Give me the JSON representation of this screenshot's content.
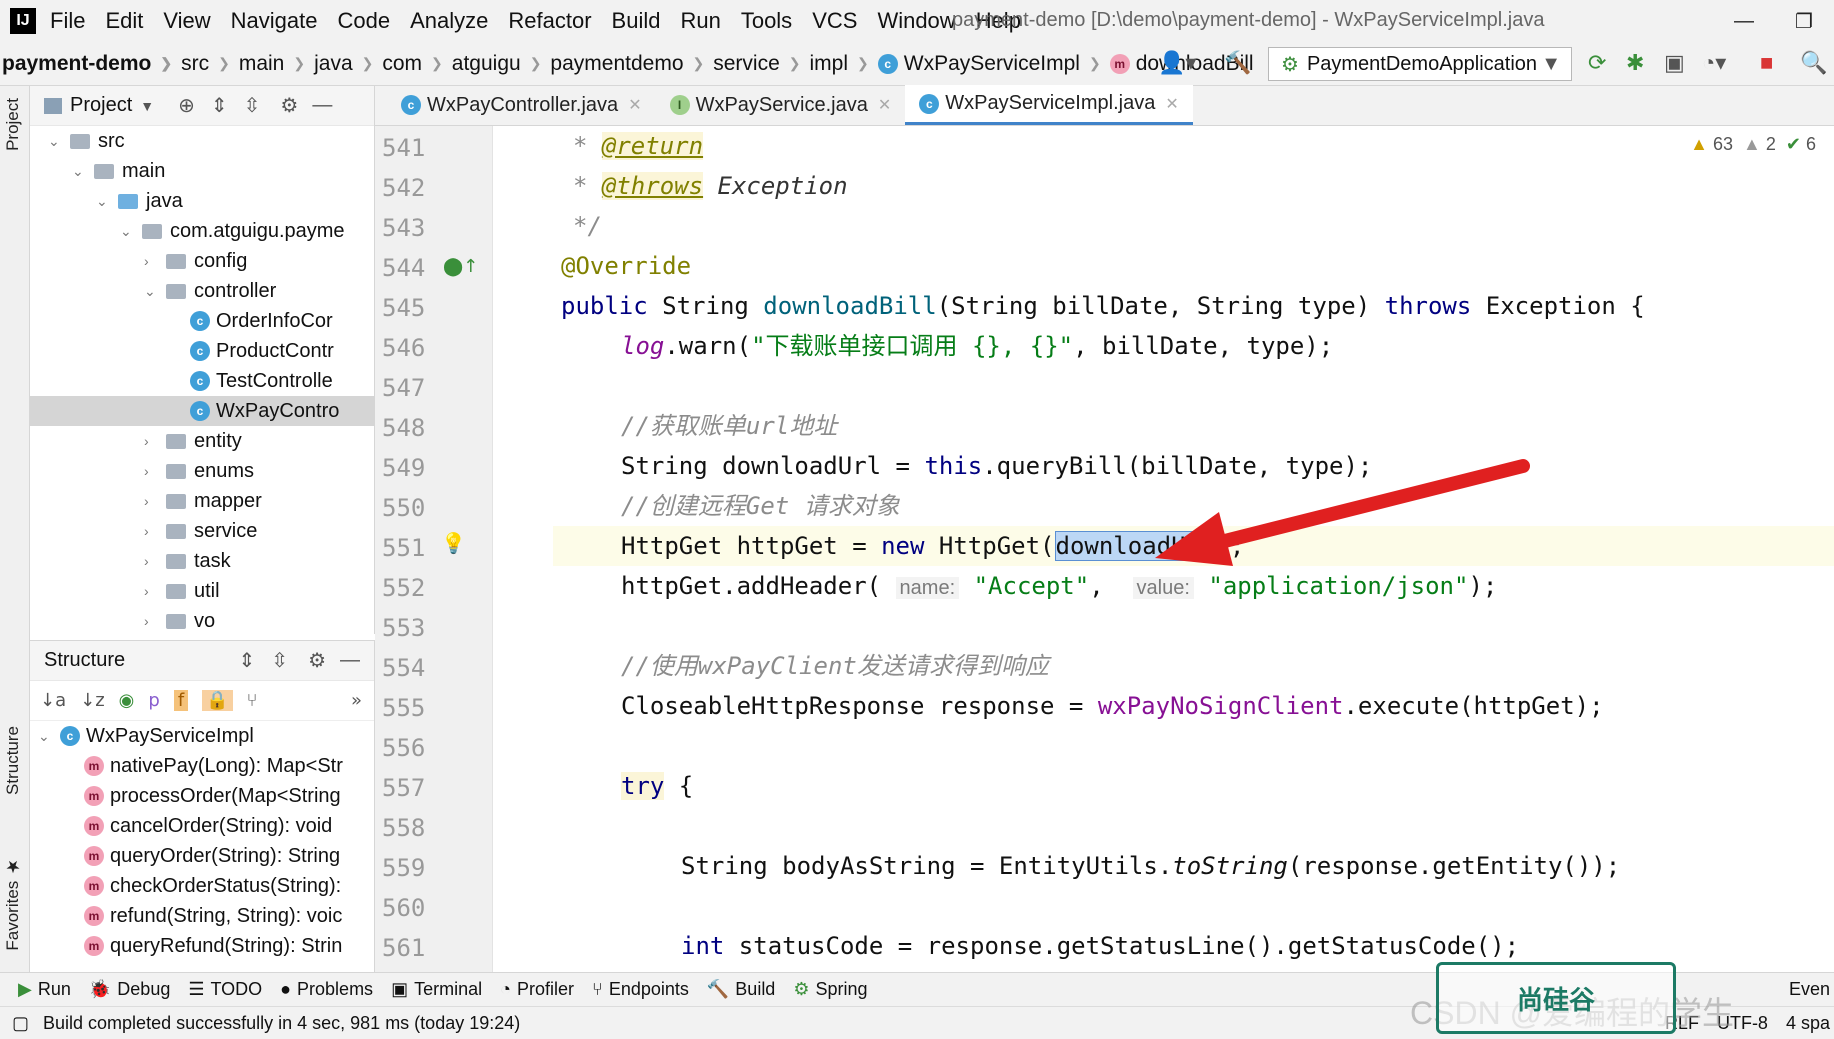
{
  "menu": {
    "logo": "IJ",
    "items": [
      "File",
      "Edit",
      "View",
      "Navigate",
      "Code",
      "Analyze",
      "Refactor",
      "Build",
      "Run",
      "Tools",
      "VCS",
      "Window",
      "Help"
    ],
    "title": "payment-demo [D:\\demo\\payment-demo] - WxPayServiceImpl.java"
  },
  "breadcrumb": [
    "payment-demo",
    "src",
    "main",
    "java",
    "com",
    "atguigu",
    "paymentdemo",
    "service",
    "impl",
    "WxPayServiceImpl",
    "downloadBill"
  ],
  "run_config": "PaymentDemoApplication",
  "project": {
    "header": "Project",
    "tree": [
      {
        "label": "src",
        "indent": 0
      },
      {
        "label": "main",
        "indent": 1
      },
      {
        "label": "java",
        "indent": 2
      },
      {
        "label": "com.atguigu.payme",
        "indent": 3
      },
      {
        "label": "config",
        "indent": 4
      },
      {
        "label": "controller",
        "indent": 4
      },
      {
        "label": "OrderInfoCor",
        "indent": 5
      },
      {
        "label": "ProductContr",
        "indent": 5
      },
      {
        "label": "TestControlle",
        "indent": 5
      },
      {
        "label": "WxPayContro",
        "indent": 5
      },
      {
        "label": "entity",
        "indent": 4
      },
      {
        "label": "enums",
        "indent": 4
      },
      {
        "label": "mapper",
        "indent": 4
      },
      {
        "label": "service",
        "indent": 4
      },
      {
        "label": "task",
        "indent": 4
      },
      {
        "label": "util",
        "indent": 4
      },
      {
        "label": "vo",
        "indent": 4
      }
    ]
  },
  "structure": {
    "header": "Structure",
    "class_name": "WxPayServiceImpl",
    "methods": [
      "nativePay(Long): Map<Str",
      "processOrder(Map<String",
      "cancelOrder(String): void",
      "queryOrder(String): String",
      "checkOrderStatus(String):",
      "refund(String, String): voic",
      "queryRefund(String): Strin"
    ]
  },
  "tabs": [
    "WxPayController.java",
    "WxPayService.java",
    "WxPayServiceImpl.java"
  ],
  "inspection": {
    "warnings": "63",
    "weak": "2",
    "ok": "6"
  },
  "line_numbers": [
    "541",
    "542",
    "543",
    "544",
    "545",
    "546",
    "547",
    "548",
    "549",
    "550",
    "551",
    "552",
    "553",
    "554",
    "555",
    "556",
    "557",
    "558",
    "559",
    "560",
    "561"
  ],
  "code": {
    "l541": [
      "* ",
      "@return"
    ],
    "l542": [
      "* ",
      "@throws",
      " Exception"
    ],
    "l543": "*/",
    "l544": "@Override",
    "l545": [
      "public",
      " String ",
      "downloadBill",
      "(String billDate, String type) ",
      "throws",
      " Exception {"
    ],
    "l546": [
      "log",
      ".warn(",
      "\"下载账单接口调用 {}, {}\"",
      ", billDate, type);"
    ],
    "l548": "//获取账单url地址",
    "l549": [
      "String downloadUrl = ",
      "this",
      ".queryBill(billDate, type);"
    ],
    "l550": "//创建远程Get 请求对象",
    "l551": [
      "HttpGet httpGet = ",
      "new",
      " HttpGet(",
      "downloadUrl",
      ");"
    ],
    "l552": [
      "httpGet.addHeader( ",
      "name:",
      " \"Accept\"",
      ",  ",
      "value:",
      " \"application/json\"",
      ");"
    ],
    "l554": "//使用wxPayClient发送请求得到响应",
    "l555": [
      "CloseableHttpResponse response = ",
      "wxPayNoSignClient",
      ".execute(httpGet);"
    ],
    "l557": [
      "try",
      " {"
    ],
    "l559": [
      "String bodyAsString = EntityUtils.",
      "toString",
      "(response.getEntity());"
    ],
    "l561": [
      "int",
      " statusCode = response.getStatusLine().getStatusCode();"
    ]
  },
  "bottom_tools": [
    "Run",
    "Debug",
    "TODO",
    "Problems",
    "Terminal",
    "Profiler",
    "Endpoints",
    "Build",
    "Spring",
    "Even"
  ],
  "status": {
    "message": "Build completed successfully in 4 sec, 981 ms (today 19:24)",
    "encoding": "UTF-8",
    "indent": "4 spa",
    "line_sep": "RLF"
  },
  "watermark": "CSDN @爱编程的学生"
}
